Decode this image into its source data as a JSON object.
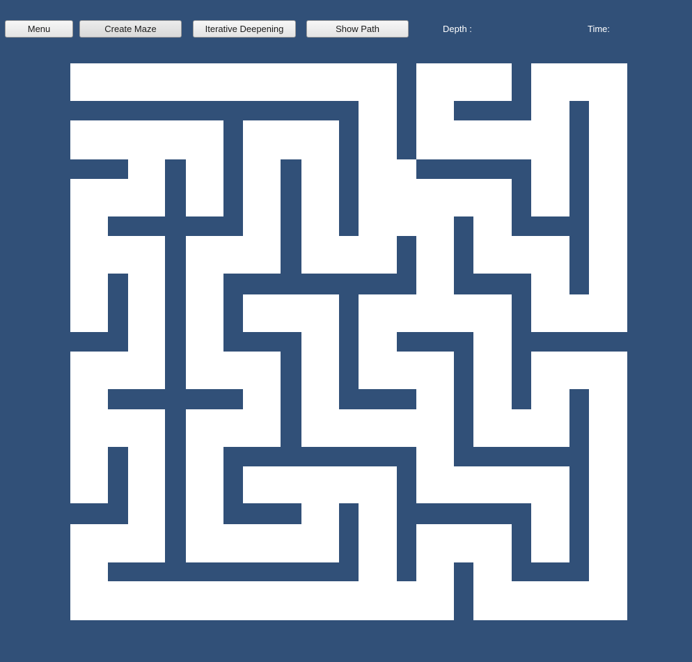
{
  "toolbar": {
    "menu_label": "Menu",
    "create_maze_label": "Create Maze",
    "iterative_deepening_label": "Iterative Deepening",
    "show_path_label": "Show Path"
  },
  "status": {
    "depth_label": "Depth :",
    "time_label": "Time:"
  },
  "colors": {
    "background": "#315078",
    "maze_floor": "#ffffff",
    "maze_wall": "#315078"
  }
}
